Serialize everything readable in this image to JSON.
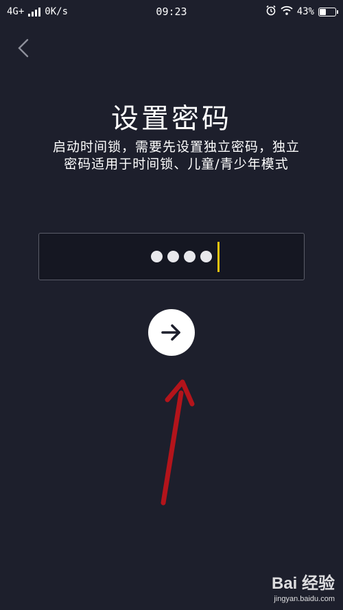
{
  "status_bar": {
    "network": "4G+",
    "speed": "0K/s",
    "time": "09:23",
    "battery_percent": "43%",
    "battery_level": 0.43
  },
  "page": {
    "title": "设置密码",
    "description": "启动时间锁，需要先设置独立密码，独立密码适用于时间锁、儿童/青少年模式"
  },
  "password": {
    "entered_digits": 4
  },
  "icons": {
    "back": "chevron-left-icon",
    "next": "arrow-right-icon",
    "alarm": "alarm-icon",
    "wifi": "wifi-icon"
  },
  "watermark": {
    "logo": "Bai 经验",
    "site": "jingyan.baidu.com"
  },
  "colors": {
    "background": "#1d1f2c",
    "caret": "#f1c40f",
    "annotation_arrow": "#b3141b"
  }
}
